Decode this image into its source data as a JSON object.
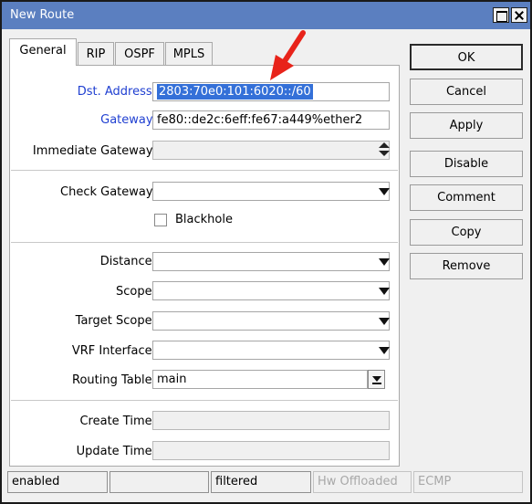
{
  "window": {
    "title": "New Route"
  },
  "tabs": [
    {
      "label": "General",
      "active": true
    },
    {
      "label": "RIP",
      "active": false
    },
    {
      "label": "OSPF",
      "active": false
    },
    {
      "label": "MPLS",
      "active": false
    }
  ],
  "form": {
    "dst_address": {
      "label": "Dst. Address:",
      "value": "2803:70e0:101:6020::/60"
    },
    "gateway": {
      "label": "Gateway:",
      "value": "fe80::de2c:6eff:fe67:a449%ether2"
    },
    "immediate_gateway": {
      "label": "Immediate Gateway:",
      "value": ""
    },
    "check_gateway": {
      "label": "Check Gateway:",
      "value": ""
    },
    "blackhole": {
      "label": "Blackhole",
      "checked": false
    },
    "distance": {
      "label": "Distance:",
      "value": ""
    },
    "scope": {
      "label": "Scope:",
      "value": ""
    },
    "target_scope": {
      "label": "Target Scope:",
      "value": ""
    },
    "vrf_interface": {
      "label": "VRF Interface:",
      "value": ""
    },
    "routing_table": {
      "label": "Routing Table:",
      "value": "main"
    },
    "create_time": {
      "label": "Create Time:",
      "value": ""
    },
    "update_time": {
      "label": "Update Time:",
      "value": ""
    }
  },
  "buttons": {
    "ok": "OK",
    "cancel": "Cancel",
    "apply": "Apply",
    "disable": "Disable",
    "comment": "Comment",
    "copy": "Copy",
    "remove": "Remove"
  },
  "status": {
    "state": "enabled",
    "empty": "",
    "filtered": "filtered",
    "hw_offloaded": "Hw Offloaded",
    "ecmp": "ECMP"
  },
  "colors": {
    "titlebar": "#5b7fc0",
    "label_link": "#1f3fd1",
    "selection": "#3470d8",
    "annotation_arrow": "#e8231a"
  }
}
